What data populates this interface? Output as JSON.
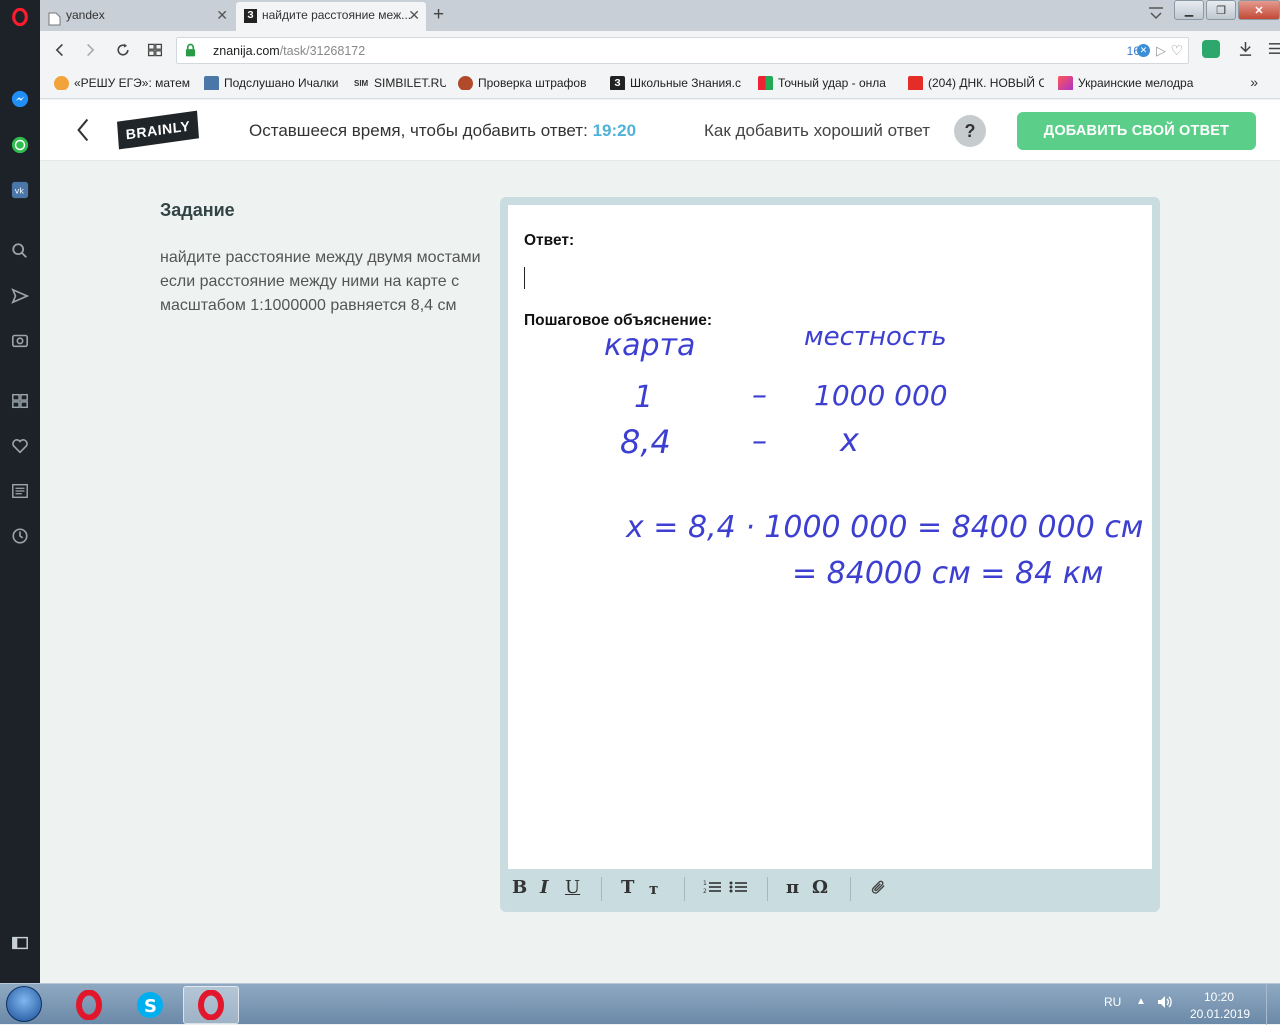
{
  "browser": {
    "tabs": [
      {
        "title": "yandex"
      },
      {
        "title": "найдите расстояние меж..."
      }
    ],
    "url_host": "znanija.com",
    "url_path": "/task/31268172",
    "url_counter": "16",
    "bookmarks": [
      "«РЕШУ ЕГЭ»: матема",
      "Подслушано Ичалки",
      "SIMBILET.RU",
      "Проверка штрафов",
      "Школьные Знания.c",
      "Точный удар - онла",
      "(204) ДНК. НОВЫЙ С",
      "Украинские мелодра"
    ]
  },
  "header": {
    "timer_label": "Оставшееся время, чтобы добавить ответ:",
    "timer_value": "19:20",
    "howto_label": "Как добавить хороший ответ",
    "help_symbol": "?",
    "add_answer_label": "ДОБАВИТЬ СВОЙ ОТВЕТ",
    "logo_text": "BRAINLY"
  },
  "task": {
    "heading": "Задание",
    "body": "найдите расстояние между двумя мостами если расстояние между ними на карте с масштабом 1:1000000 равняется 8,4 см"
  },
  "editor": {
    "answer_label": "Ответ:",
    "explanation_label": "Пошаговое объяснение:",
    "handwriting": {
      "line1": [
        "карта",
        "местность"
      ],
      "line2": [
        "1",
        "–",
        "1000 000"
      ],
      "line3": [
        "8,4",
        "–",
        "x"
      ],
      "line4": "x = 8,4 · 1000 000 = 8400 000 см",
      "line5": "= 84000 см = 84 км"
    },
    "toolbar": [
      "B",
      "I",
      "U",
      "T",
      "т",
      "list-ordered-icon",
      "list-bullets-icon",
      "π",
      "Ω",
      "paperclip-icon"
    ]
  },
  "taskbar": {
    "lang": "RU",
    "time": "10:20",
    "date": "20.01.2019"
  },
  "colors": {
    "accent_green": "#5bcf8a",
    "timer_blue": "#4fb3d9",
    "ink_blue": "#3c3fd0"
  }
}
